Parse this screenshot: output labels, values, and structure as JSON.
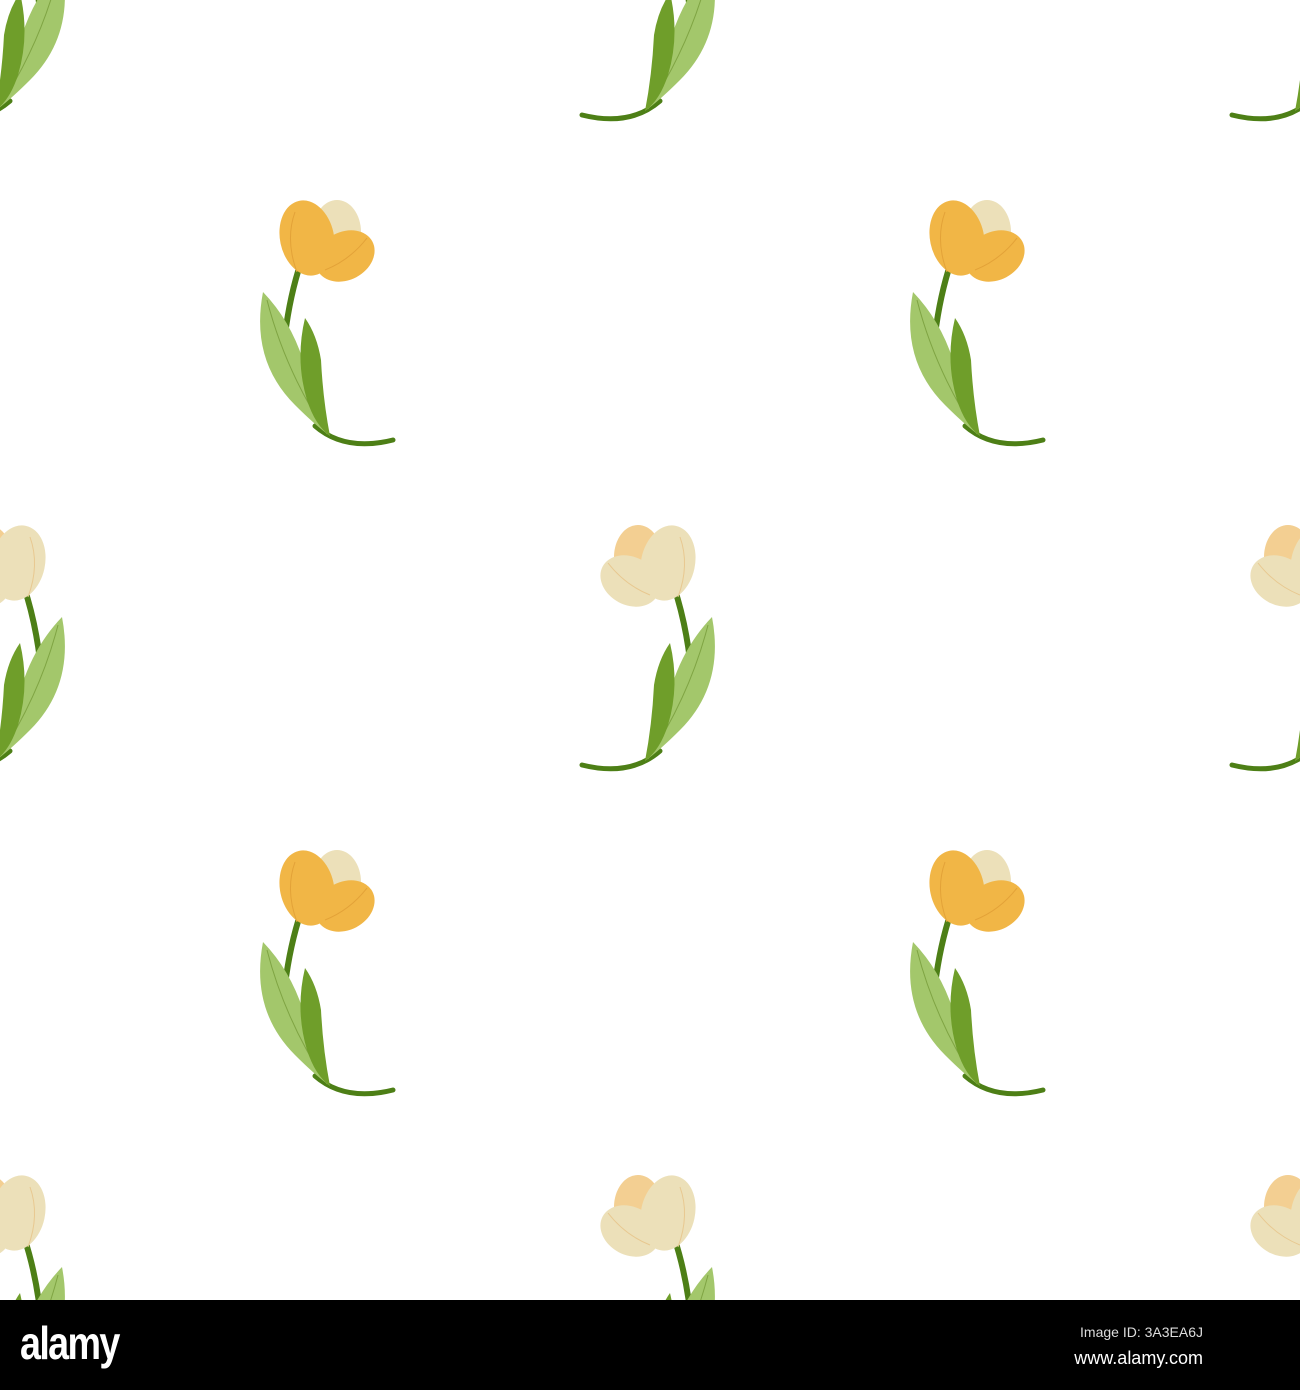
{
  "pattern": {
    "name": "tulip seamless pattern",
    "colors": {
      "background": "#ffffff",
      "orange_petal": "#f1b646",
      "cream_petal": "#ece0b9",
      "peach_petal": "#f3cf92",
      "leaf_light": "#a3c76b",
      "leaf_dark": "#6f9e2a",
      "stem": "#4d7f16"
    }
  },
  "watermark": {
    "logo": "alamy",
    "image_id": "Image ID: 3A3EA6J",
    "url": "www.alamy.com"
  }
}
